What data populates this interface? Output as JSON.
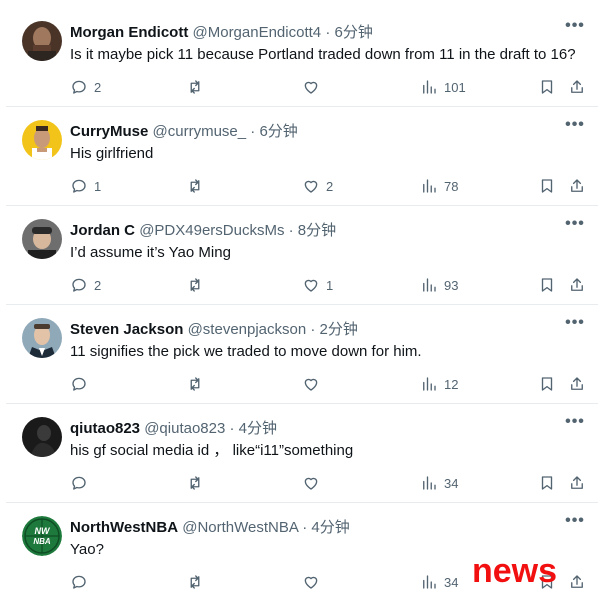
{
  "replies": [
    {
      "name": "Morgan Endicott",
      "handle": "@MorganEndicott4",
      "sep": "·",
      "time": "6分钟",
      "text": "Is it maybe pick 11 because Portland traded down from 11 in the draft to 16?",
      "replies": "2",
      "reposts": "",
      "likes": "",
      "views": "101",
      "avatar_color": "#6b4a3a"
    },
    {
      "name": "CurryMuse",
      "handle": "@currymuse_",
      "sep": "·",
      "time": "6分钟",
      "text": "His girlfriend",
      "replies": "1",
      "reposts": "",
      "likes": "2",
      "views": "78",
      "avatar_color": "#f2c41a"
    },
    {
      "name": "Jordan C",
      "handle": "@PDX49ersDucksMs",
      "sep": "·",
      "time": "8分钟",
      "text": "I’d assume it’s Yao Ming",
      "replies": "2",
      "reposts": "",
      "likes": "1",
      "views": "93",
      "avatar_color": "#3c3c3c"
    },
    {
      "name": "Steven Jackson",
      "handle": "@stevenpjackson",
      "sep": "·",
      "time": "2分钟",
      "text": "11 signifies the pick we traded to move down for him.",
      "replies": "",
      "reposts": "",
      "likes": "",
      "views": "12",
      "avatar_color": "#5f7f96"
    },
    {
      "name": "qiutao823",
      "handle": "@qiutao823",
      "sep": "·",
      "time": "4分钟",
      "text": "his gf social media id ， like“i11”something",
      "replies": "",
      "reposts": "",
      "likes": "",
      "views": "34",
      "avatar_color": "#1a1a1a"
    },
    {
      "name": "NorthWestNBA",
      "handle": "@NorthWestNBA",
      "sep": "·",
      "time": "4分钟",
      "text": "Yao?",
      "replies": "",
      "reposts": "",
      "likes": "",
      "views": "34",
      "avatar_color": "#1e7a3c",
      "avatar_text": "NW NBA"
    }
  ],
  "more_label": "•••",
  "watermark": "news"
}
